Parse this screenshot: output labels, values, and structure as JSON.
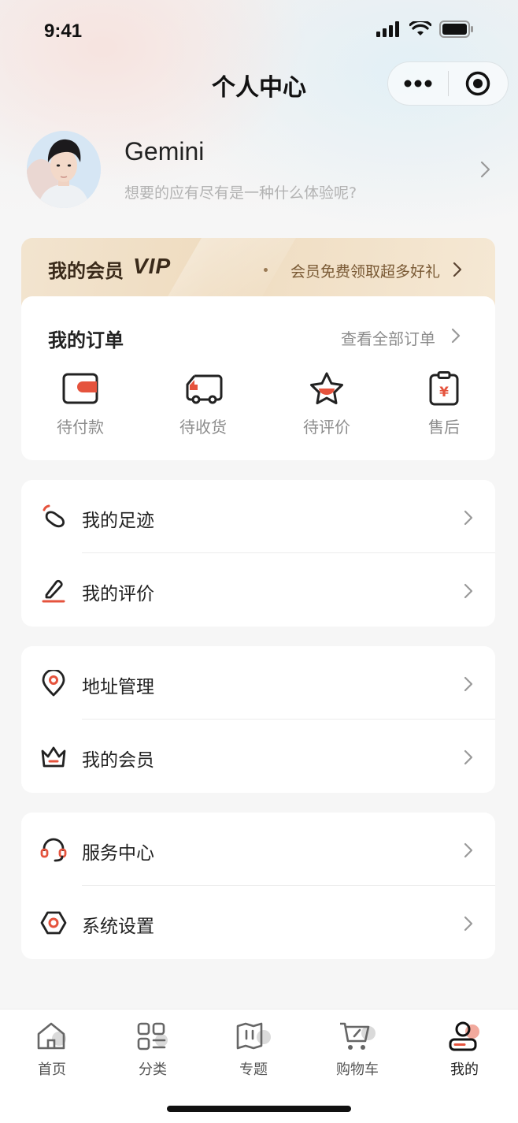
{
  "status_bar": {
    "time": "9:41"
  },
  "nav": {
    "title": "个人中心"
  },
  "profile": {
    "name": "Gemini",
    "slogan": "想要的应有尽有是一种什么体验呢?"
  },
  "vip": {
    "title": "我的会员",
    "badge": "VIP",
    "promo": "会员免费领取超多好礼"
  },
  "orders": {
    "title": "我的订单",
    "view_all": "查看全部订单",
    "items": [
      {
        "label": "待付款",
        "icon": "wallet-icon"
      },
      {
        "label": "待收货",
        "icon": "truck-icon"
      },
      {
        "label": "待评价",
        "icon": "star-icon"
      },
      {
        "label": "售后",
        "icon": "receipt-icon"
      }
    ]
  },
  "menu_groups": [
    [
      {
        "label": "我的足迹",
        "icon": "footprint-icon"
      },
      {
        "label": "我的评价",
        "icon": "pen-icon"
      }
    ],
    [
      {
        "label": "地址管理",
        "icon": "location-icon"
      },
      {
        "label": "我的会员",
        "icon": "crown-icon"
      }
    ],
    [
      {
        "label": "服务中心",
        "icon": "headset-icon"
      },
      {
        "label": "系统设置",
        "icon": "settings-icon"
      }
    ]
  ],
  "tabbar": {
    "items": [
      {
        "label": "首页",
        "icon": "home-icon"
      },
      {
        "label": "分类",
        "icon": "category-icon"
      },
      {
        "label": "专题",
        "icon": "topic-icon"
      },
      {
        "label": "购物车",
        "icon": "cart-icon"
      },
      {
        "label": "我的",
        "icon": "user-icon"
      }
    ],
    "active": "我的"
  },
  "colors": {
    "accent": "#e5533d",
    "vip_bg": "#f0e0c6",
    "text": "#222222",
    "muted": "#8c8c8c"
  }
}
